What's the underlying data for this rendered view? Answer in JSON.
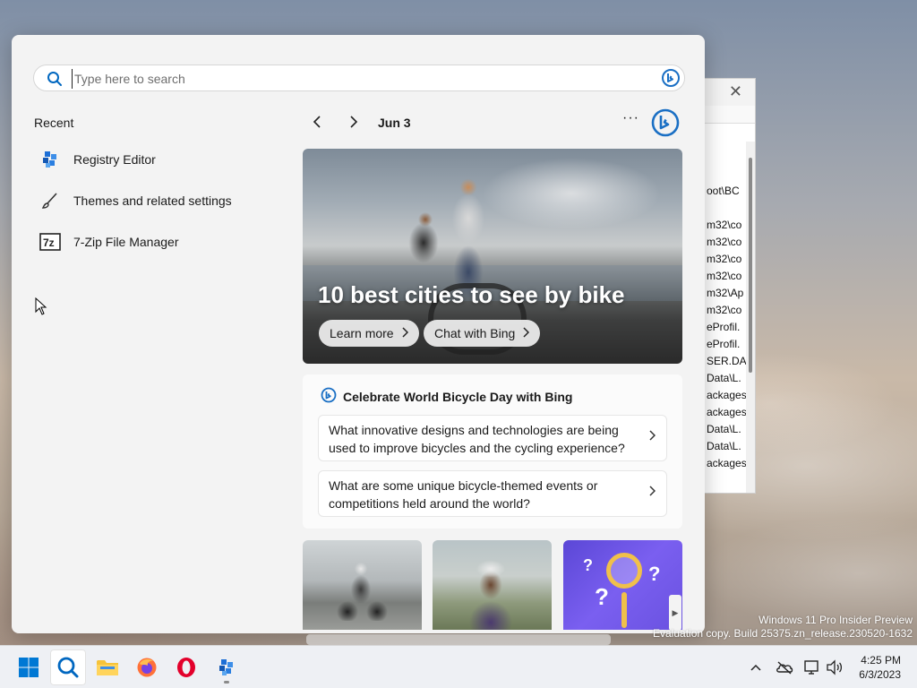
{
  "search": {
    "placeholder": "Type here to search"
  },
  "recent": {
    "title": "Recent",
    "items": [
      {
        "label": "Registry Editor",
        "icon": "registry-editor-icon"
      },
      {
        "label": "Themes and related settings",
        "icon": "brush-icon"
      },
      {
        "label": "7-Zip File Manager",
        "icon": "seven-zip-icon"
      }
    ]
  },
  "date_nav": {
    "date": "Jun 3",
    "more": "···"
  },
  "hero": {
    "title": "10 best cities to see by bike",
    "learn_more": "Learn more",
    "chat_with_bing": "Chat with Bing"
  },
  "celebrate": {
    "title": "Celebrate World Bicycle Day with Bing",
    "questions": [
      "What innovative designs and technologies are being used to improve bicycles and the cycling experience?",
      "What are some unique bicycle-themed events or competitions held around the world?"
    ]
  },
  "thumb_glyphs": {
    "q1": "?",
    "q2": "?",
    "q3": "?"
  },
  "background_window": {
    "close": "✕",
    "lines": [
      "oot\\BC",
      "",
      "m32\\co",
      "m32\\co",
      "m32\\co",
      "m32\\co",
      "m32\\Ap",
      "m32\\co",
      "eProfil.",
      "eProfil.",
      "SER.DA",
      "Data\\L.",
      "ackages",
      "ackages",
      "Data\\L.",
      "Data\\L.",
      "ackages"
    ]
  },
  "watermark": {
    "line1": "Windows 11 Pro Insider Preview",
    "line2": "Evaluation copy. Build 25375.zn_release.230520-1632"
  },
  "taskbar": {
    "clock_time": "4:25 PM",
    "clock_date": "6/3/2023"
  },
  "colors": {
    "accent": "#0067c0",
    "bing_blue": "#1a6fc4",
    "opera_red": "#e3002b",
    "folder_yellow": "#f6c33a"
  }
}
